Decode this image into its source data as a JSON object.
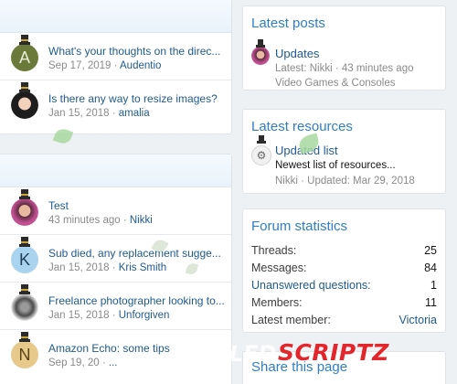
{
  "block1": {
    "threads": [
      {
        "title": "What's your thoughts on the direc...",
        "date": "Sep 17, 2019",
        "user": "Audentio",
        "avatar_letter": "A",
        "avatar_color": "#6b7a3a",
        "avatar_kind": "letter"
      },
      {
        "title": "Is there any way to resize images?",
        "date": "Jan 15, 2018",
        "user": "amalia",
        "avatar_letter": "",
        "avatar_color": "#1d1d1d",
        "avatar_kind": "photo-dark"
      }
    ]
  },
  "block2": {
    "threads": [
      {
        "title": "Test",
        "date": "43 minutes ago",
        "user": "Nikki",
        "avatar_letter": "",
        "avatar_color": "#c34f93",
        "avatar_kind": "photo-pink"
      },
      {
        "title": "Sub died, any replacement sugge...",
        "date": "Jan 15, 2018",
        "user": "Kris Smith",
        "avatar_letter": "K",
        "avatar_color": "#a9d3ee",
        "avatar_kind": "letter"
      },
      {
        "title": "Freelance photographer looking to...",
        "date": "Jan 15, 2018",
        "user": "Unforgiven",
        "avatar_letter": "",
        "avatar_color": "#4d4d4d",
        "avatar_kind": "photo-bw"
      },
      {
        "title": "Amazon Echo: some tips",
        "date": "Sep 19, 20",
        "user": "...",
        "avatar_letter": "N",
        "avatar_color": "#e8c98c",
        "avatar_kind": "letter"
      }
    ]
  },
  "latest_posts": {
    "heading": "Latest posts",
    "title": "Updates",
    "meta": "Latest: Nikki · 43 minutes ago",
    "forum": "Video Games & Consoles"
  },
  "latest_resources": {
    "heading": "Latest resources",
    "title": "Updated list",
    "description": "Newest list of resources...",
    "meta": "Nikki · Updated: Mar 29, 2018",
    "icon": "gear-icon"
  },
  "forum_statistics": {
    "heading": "Forum statistics",
    "stats": [
      {
        "label": "Threads:",
        "value": "25",
        "label_link": false,
        "value_link": false
      },
      {
        "label": "Messages:",
        "value": "84",
        "label_link": false,
        "value_link": false
      },
      {
        "label": "Unanswered questions:",
        "value": "1",
        "label_link": true,
        "value_link": false
      },
      {
        "label": "Members:",
        "value": "11",
        "label_link": false,
        "value_link": false
      },
      {
        "label": "Latest member:",
        "value": "Victoria",
        "label_link": false,
        "value_link": true
      }
    ]
  },
  "share": {
    "heading": "Share this page"
  },
  "watermark": {
    "text": "SCRIPTZ",
    "ghost_text": "NULLED",
    "color": "#e3262b"
  },
  "colors": {
    "link": "#1f5a8c",
    "heading": "#2f7fc2",
    "muted": "#8a8a8a"
  }
}
